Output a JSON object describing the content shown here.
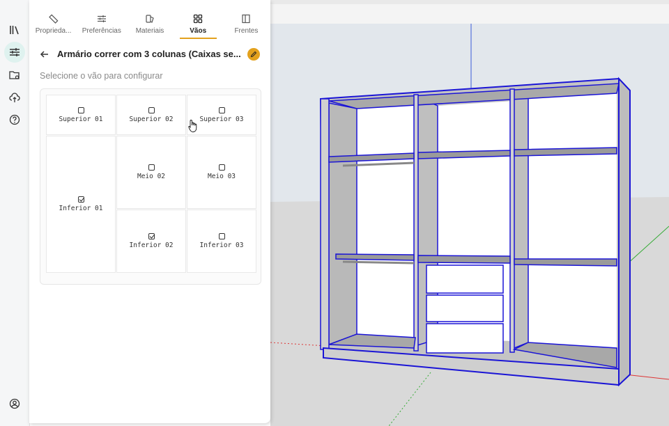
{
  "rail": {
    "items": [
      {
        "name": "library-icon",
        "active": false
      },
      {
        "name": "sliders-icon",
        "active": true
      },
      {
        "name": "folder-settings-icon",
        "active": false
      },
      {
        "name": "cloud-upload-icon",
        "active": false
      },
      {
        "name": "help-icon",
        "active": false
      },
      {
        "name": "user-icon",
        "active": false
      }
    ]
  },
  "tabs": [
    {
      "label": "Proprieda...",
      "icon": "ruler-icon",
      "active": false
    },
    {
      "label": "Preferências",
      "icon": "sliders-icon",
      "active": false
    },
    {
      "label": "Materiais",
      "icon": "materials-icon",
      "active": false
    },
    {
      "label": "Vãos",
      "icon": "grid-icon",
      "active": true
    },
    {
      "label": "Frentes",
      "icon": "door-icon",
      "active": false
    }
  ],
  "header": {
    "title": "Armário correr com 3 colunas (Caixas se..."
  },
  "subtitle": "Selecione o vão para configurar",
  "cells": {
    "superior_01": {
      "label": "Superior 01",
      "checked": false
    },
    "superior_02": {
      "label": "Superior 02",
      "checked": false
    },
    "superior_03": {
      "label": "Superior 03",
      "checked": false
    },
    "inferior_01": {
      "label": "Inferior 01",
      "checked": true
    },
    "meio_02": {
      "label": "Meio 02",
      "checked": false
    },
    "meio_03": {
      "label": "Meio 03",
      "checked": false
    },
    "inferior_02": {
      "label": "Inferior 02",
      "checked": true
    },
    "inferior_03": {
      "label": "Inferior 03",
      "checked": false
    }
  },
  "colors": {
    "accent": "#e3a11d",
    "rail_active": "#dff2ef",
    "model_edges": "#1a14d6"
  }
}
